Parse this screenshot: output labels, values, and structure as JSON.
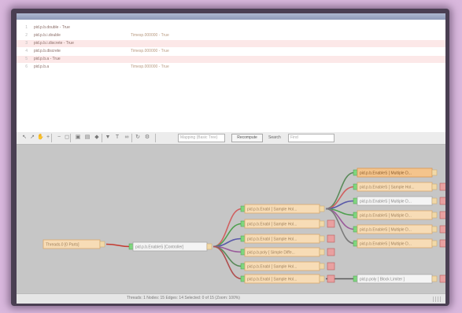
{
  "log": {
    "rows": [
      {
        "line": "1",
        "text": "pid.p.b.double - True",
        "right": "",
        "highlight": false
      },
      {
        "line": "2",
        "text": "pid.p.b.i.double",
        "right": "Timesp.000000 - True",
        "highlight": false
      },
      {
        "line": "3",
        "text": "pid.p.b.i.discrete - True",
        "right": "",
        "highlight": true
      },
      {
        "line": "4",
        "text": "pid.p.b.discrete",
        "right": "Timesp.000000 - True",
        "highlight": false
      },
      {
        "line": "5",
        "text": "pid.p.b.a - True",
        "right": "",
        "highlight": true
      },
      {
        "line": "6",
        "text": "pid.p.b.a",
        "right": "Timesp.000000 - True",
        "highlight": false
      }
    ]
  },
  "toolbar": {
    "icons": [
      "arrow-icon",
      "pointer-icon",
      "hand-icon",
      "zoom-in-icon",
      "zoom-out-icon",
      "fit-icon",
      "lock-icon",
      "folder-icon",
      "tag-icon",
      "filter-icon",
      "text-icon",
      "link-icon",
      "refresh-icon",
      "settings-icon"
    ],
    "combo_value": "Mapping (Basic Tree)",
    "apply_label": "Recompute",
    "search_label": "Search",
    "search_placeholder": "Find"
  },
  "graph": {
    "nodes": [
      {
        "id": "root",
        "label": "Threads.0 [0 Parts]",
        "style": "orange",
        "flag": "none"
      },
      {
        "id": "hub",
        "label": "pid.p.b.EnableS [Controller]",
        "style": "white",
        "flag": "none"
      },
      {
        "id": "m1",
        "label": "pid.p.b.Enabl [ Sample Hol...",
        "style": "orange",
        "flag": "none"
      },
      {
        "id": "m2",
        "label": "pid.p.b.Enabl [ Sample Hol...",
        "style": "orange",
        "flag": "red"
      },
      {
        "id": "m3",
        "label": "pid.p.b.Enabl [ Sample Hol...",
        "style": "orange",
        "flag": "red"
      },
      {
        "id": "m4",
        "label": "pid.p.b.poly [ Simple Diffe...",
        "style": "orange",
        "flag": "red"
      },
      {
        "id": "m5",
        "label": "pid.p.b.Enabl [ Sample Hol...",
        "style": "orange",
        "flag": "red"
      },
      {
        "id": "m6",
        "label": "pid.p.b.Enabl [ Sample Hol...",
        "style": "orange",
        "flag": "red"
      },
      {
        "id": "r1",
        "label": "pid.p.b.EnableS [ Multiple D...",
        "style": "orange-solid",
        "flag": "none"
      },
      {
        "id": "r2",
        "label": "pid.p.b.EnableS [ Sample Hol...",
        "style": "orange",
        "flag": "red"
      },
      {
        "id": "r3",
        "label": "pid.p.b.EnableS [ Multiple D...",
        "style": "white",
        "flag": "red"
      },
      {
        "id": "r4",
        "label": "pid.p.b.EnableS [ Multiple D...",
        "style": "orange",
        "flag": "red"
      },
      {
        "id": "r5",
        "label": "pid.p.b.EnableS [ Multiple D...",
        "style": "orange",
        "flag": "red"
      },
      {
        "id": "r6",
        "label": "pid.p.b.EnableS [ Multiple D...",
        "style": "orange",
        "flag": "red"
      },
      {
        "id": "r7",
        "label": "pid.p.poly [ Block Limiter ]",
        "style": "white",
        "flag": "red"
      }
    ],
    "edges": [
      {
        "from": "root",
        "to": "hub",
        "color": "#c43a30"
      },
      {
        "from": "hub",
        "to": "m1",
        "color": "#d06060"
      },
      {
        "from": "hub",
        "to": "m2",
        "color": "#50a050"
      },
      {
        "from": "hub",
        "to": "m3",
        "color": "#5a5aa8"
      },
      {
        "from": "hub",
        "to": "m4",
        "color": "#9a5a9a"
      },
      {
        "from": "hub",
        "to": "m5",
        "color": "#5a8a5a"
      },
      {
        "from": "hub",
        "to": "m6",
        "color": "#b05050"
      },
      {
        "from": "m1",
        "to": "r1",
        "color": "#5a8a5a"
      },
      {
        "from": "m1",
        "to": "r2",
        "color": "#d06060"
      },
      {
        "from": "m1",
        "to": "r3",
        "color": "#5a5aa8"
      },
      {
        "from": "m1",
        "to": "r4",
        "color": "#50a050"
      },
      {
        "from": "m1",
        "to": "r5",
        "color": "#9a5a9a"
      },
      {
        "from": "m1",
        "to": "r6",
        "color": "#7a7a7a"
      },
      {
        "from": "m6",
        "to": "r7",
        "color": "#5a5a5a"
      }
    ]
  },
  "status": {
    "text": "Threads: 1 Nodes: 15 Edges: 14 Selected: 0 of 15 (Zoom: 100%)"
  }
}
